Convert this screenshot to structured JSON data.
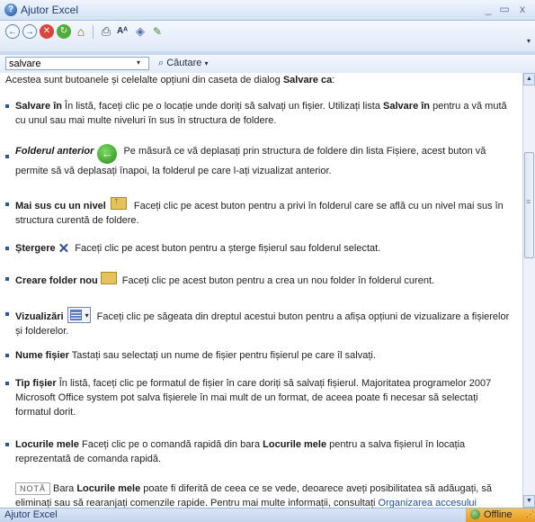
{
  "window": {
    "title": "Ajutor Excel",
    "title_icon": "help-icon",
    "minimize": "_",
    "maximize": "▭",
    "close": "x"
  },
  "toolbar": {
    "icons": [
      "back-icon",
      "forward-icon",
      "stop-icon",
      "refresh-icon",
      "home-icon",
      "print-icon",
      "font-size-icon",
      "book-icon",
      "pin-icon"
    ],
    "glyphs": {
      "back": "←",
      "forward": "→",
      "stop": "✕",
      "refresh": "↻",
      "home": "⌂",
      "print": "⎙",
      "font": "Aᴬ",
      "book": "◈",
      "pin": "✎",
      "overflow": "▾"
    }
  },
  "search": {
    "value": "salvare",
    "dropdown": "▾",
    "button_label": "Căutare",
    "button_icon": "⌕",
    "button_arrow": "▾"
  },
  "content": {
    "intro": {
      "text": "Acestea sunt butoanele și celelalte opțiuni din caseta de dialog ",
      "bold": "Salvare ca",
      "end": ":"
    },
    "items": [
      {
        "term": "Salvare în",
        "text1": "   În listă, faceți clic pe o locație unde doriți să salvați un fișier. Utilizați lista ",
        "bold2": "Salvare în",
        "text2": " pentru a vă mută cu unul sau mai multe niveluri în sus în structura de foldere."
      },
      {
        "term": "Folderul anterior",
        "icon_glyph": "←",
        "text1": " Pe măsură ce vă deplasați prin structura de foldere din lista Fișiere, acest buton vă permite să vă deplasați înapoi, la folderul pe care l-ați vizualizat anterior."
      },
      {
        "term": "Mai sus cu un nivel",
        "text1": " Faceți clic pe acest buton pentru a privi în folderul care se află cu un nivel mai sus în structura curentă de foldere."
      },
      {
        "term": "Ștergere",
        "icon_glyph": "✕",
        "text1": " Faceți clic pe acest buton pentru a șterge fișierul sau folderul selectat."
      },
      {
        "term": "Creare folder nou",
        "text1": " Faceți clic pe acest buton pentru a crea un nou folder în folderul curent."
      },
      {
        "term": "Vizualizări",
        "icon_glyph": "▾",
        "text1": " Faceți clic pe săgeata din dreptul acestui buton pentru a afișa opțiuni de vizualizare a fișierelor și folderelor."
      },
      {
        "term": "Nume fișier",
        "text1": "   Tastați sau selectați un nume de fișier pentru fișierul pe care îl salvați."
      },
      {
        "term": "Tip fișier",
        "text1": "   În listă, faceți clic pe formatul de fișier în care doriți să salvați fișierul. Majoritatea programelor 2007 Microsoft Office system pot salva fișierele în mai mult de un format, de aceea poate fi necesar să selectați formatul dorit."
      },
      {
        "term": "Locurile mele",
        "text1": "   Faceți clic pe o comandă rapidă din bara ",
        "bold2": "Locurile mele",
        "text2": " pentru a salva fișierul în locația reprezentată de comanda rapidă."
      }
    ],
    "nota": {
      "tag": "NOTĂ",
      "text1": "Bara ",
      "bold": "Locurile mele",
      "text2": " poate fi diferită de ceea ce se vede, deoarece aveți posibilitatea să adăugați, să eliminați sau să rearanjați comenzile rapide. Pentru mai multe informații, consultați ",
      "link": "Organizarea accesului"
    }
  },
  "scrollbar": {
    "up": "▲",
    "down": "▼"
  },
  "status": {
    "left": "Ajutor Excel",
    "right": "Offline",
    "grip": "⋰"
  }
}
